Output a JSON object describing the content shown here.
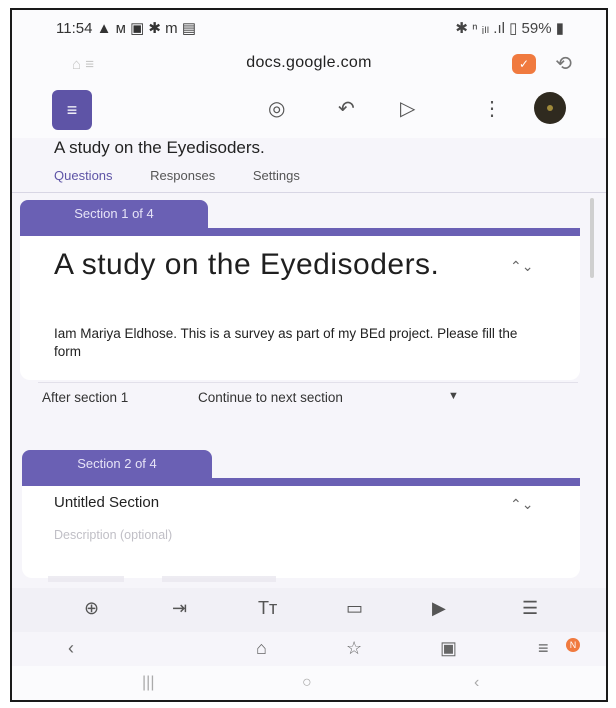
{
  "status": {
    "time": "11:54 ▲ ᴍ ▣ ✱ m ▤",
    "right": "✱ ⁿ ᵢₗₗ .ıl ▯ 59% ▮"
  },
  "browser": {
    "url": "docs.google.com",
    "home_icon": "⌂ ≡"
  },
  "form": {
    "title": "A study on the Eyedisoders.",
    "tabs": [
      "Questions",
      "Responses",
      "Settings"
    ],
    "section1": {
      "label": "Section 1 of 4",
      "heading": "A study on the Eyedisoders.",
      "description": "Iam Mariya Eldhose. This is a survey as part of my BEd project. Please fill the form"
    },
    "after_section": {
      "label": "After section 1",
      "value": "Continue to next section"
    },
    "section2": {
      "label": "Section 2 of 4",
      "heading": "Untitled Section",
      "description_placeholder": "Description (optional)"
    }
  },
  "icons": {
    "palette": "palette-icon",
    "undo": "undo-icon",
    "send": "send-icon",
    "more": "more-vert-icon",
    "add": "add-circle-icon",
    "import": "import-icon",
    "text": "title-text-icon",
    "image": "image-icon",
    "video": "video-icon",
    "section": "section-icon"
  },
  "badge_count": "N",
  "colors": {
    "accent": "#6a60b4",
    "shield": "#f07a3f"
  }
}
